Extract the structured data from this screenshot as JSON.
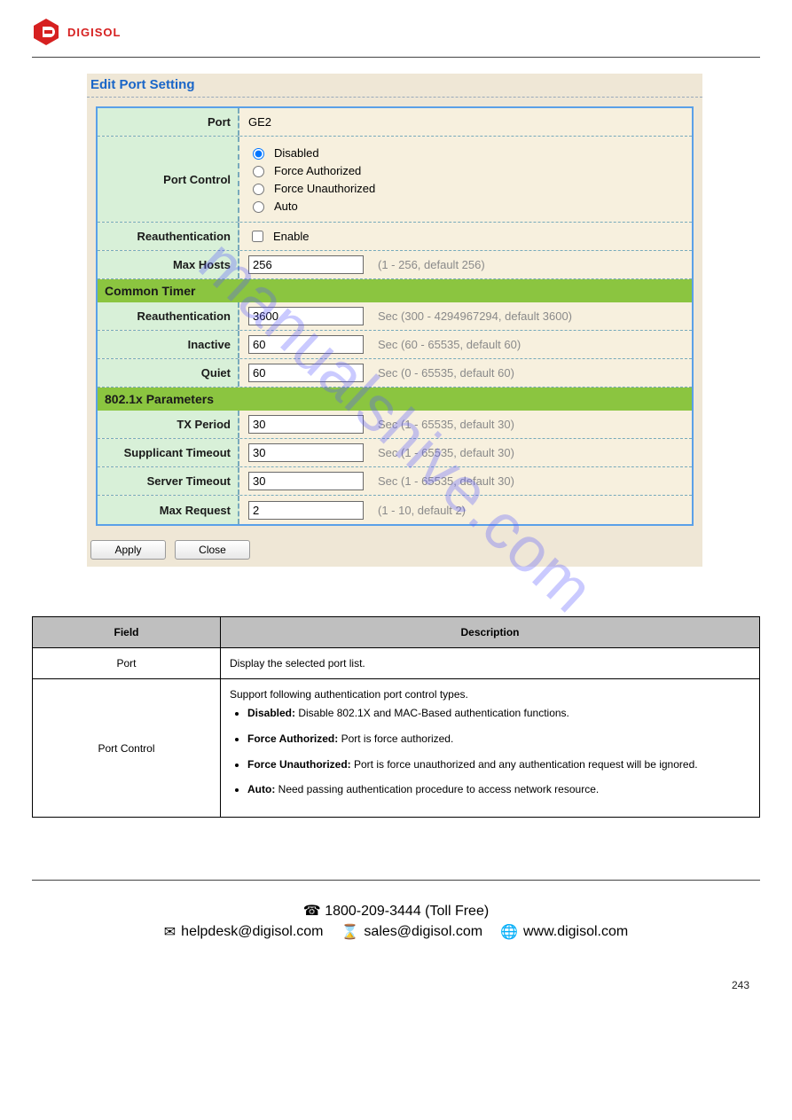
{
  "brand": "DIGISOL",
  "watermark": "manualshive.com",
  "shot": {
    "title": "Edit Port Setting",
    "port_label": "Port",
    "port_value": "GE2",
    "port_control_label": "Port Control",
    "port_control_options": {
      "disabled": "Disabled",
      "force_auth": "Force Authorized",
      "force_unauth": "Force Unauthorized",
      "auto": "Auto"
    },
    "reauth_label": "Reauthentication",
    "reauth_checkbox": "Enable",
    "max_hosts_label": "Max Hosts",
    "max_hosts_value": "256",
    "max_hosts_hint": "(1 - 256, default 256)",
    "common_timer_header": "Common Timer",
    "ct_reauth_label": "Reauthentication",
    "ct_reauth_value": "3600",
    "ct_reauth_hint": "Sec (300 - 4294967294, default 3600)",
    "ct_inactive_label": "Inactive",
    "ct_inactive_value": "60",
    "ct_inactive_hint": "Sec (60 - 65535, default 60)",
    "ct_quiet_label": "Quiet",
    "ct_quiet_value": "60",
    "ct_quiet_hint": "Sec (0 - 65535, default 60)",
    "dot1x_header": "802.1x Parameters",
    "tx_period_label": "TX Period",
    "tx_period_value": "30",
    "tx_period_hint": "Sec (1 - 65535, default 30)",
    "supp_timeout_label": "Supplicant Timeout",
    "supp_timeout_value": "30",
    "supp_timeout_hint": "Sec (1 - 65535, default 30)",
    "server_timeout_label": "Server Timeout",
    "server_timeout_value": "30",
    "server_timeout_hint": "Sec (1 - 65535, default 30)",
    "max_req_label": "Max Request",
    "max_req_value": "2",
    "max_req_hint": "(1 - 10, default 2)",
    "apply_btn": "Apply",
    "close_btn": "Close"
  },
  "table": {
    "th_field": "Field",
    "th_desc": "Description",
    "row1_field": "Port",
    "row1_desc": "Display the selected port list.",
    "row2_field": "Port Control",
    "row2_intro": "Support following authentication port control types.",
    "row2_b1a": "Disabled:",
    "row2_b1b": " Disable 802.1X and MAC-Based authentication functions.",
    "row2_b2a": "Force Authorized:",
    "row2_b2b": " Port is force authorized.",
    "row2_b3a": "Force Unauthorized:",
    "row2_b3b": " Port is force unauthorized and any authentication request will be ignored.",
    "row2_b4a": "Auto:",
    "row2_b4b": " Need passing authentication procedure to access network resource."
  },
  "footer": {
    "phone": "1800-209-3444 (Toll Free)",
    "helpdesk": "helpdesk@digisol.com",
    "sales": "sales@digisol.com",
    "web": "www.digisol.com"
  },
  "page_number": "243"
}
